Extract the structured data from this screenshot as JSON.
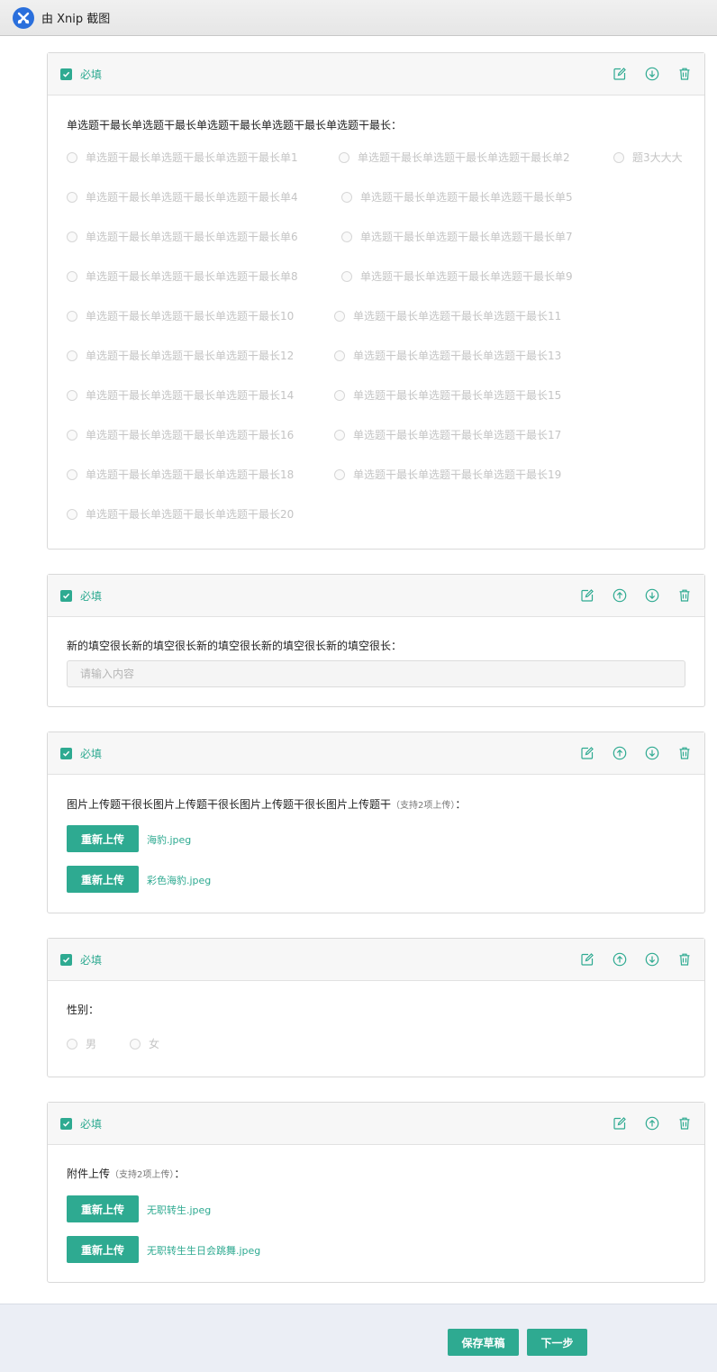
{
  "window": {
    "title": "由 Xnip 截图"
  },
  "colors": {
    "accent": "#2eaa91",
    "disabled_text": "#c4c4c4",
    "footer_bg": "#ebeef5"
  },
  "cards": [
    {
      "required_label": "必填",
      "title": "单选题干最长单选题干最长单选题干最长单选题干最长单选题干最长：",
      "options": [
        "单选题干最长单选题干最长单选题干最长单1",
        "单选题干最长单选题干最长单选题干最长单2",
        "题3大大大",
        "单选题干最长单选题干最长单选题干最长单4",
        "单选题干最长单选题干最长单选题干最长单5",
        "单选题干最长单选题干最长单选题干最长单6",
        "单选题干最长单选题干最长单选题干最长单7",
        "单选题干最长单选题干最长单选题干最长单8",
        "单选题干最长单选题干最长单选题干最长单9",
        "单选题干最长单选题干最长单选题干最长10",
        "单选题干最长单选题干最长单选题干最长11",
        "单选题干最长单选题干最长单选题干最长12",
        "单选题干最长单选题干最长单选题干最长13",
        "单选题干最长单选题干最长单选题干最长14",
        "单选题干最长单选题干最长单选题干最长15",
        "单选题干最长单选题干最长单选题干最长16",
        "单选题干最长单选题干最长单选题干最长17",
        "单选题干最长单选题干最长单选题干最长18",
        "单选题干最长单选题干最长单选题干最长19",
        "单选题干最长单选题干最长单选题干最长20"
      ]
    },
    {
      "required_label": "必填",
      "title": "新的填空很长新的填空很长新的填空很长新的填空很长新的填空很长：",
      "input_placeholder": "请输入内容"
    },
    {
      "required_label": "必填",
      "title": "图片上传题干很长图片上传题干很长图片上传题干很长图片上传题干",
      "title_note": "（支持2项上传）",
      "title_suffix": "：",
      "uploads": [
        {
          "button": "重新上传",
          "file": "海豹.jpeg"
        },
        {
          "button": "重新上传",
          "file": "彩色海豹.jpeg"
        }
      ]
    },
    {
      "required_label": "必填",
      "title": "性别：",
      "options": [
        "男",
        "女"
      ]
    },
    {
      "required_label": "必填",
      "title": "附件上传",
      "title_note": "（支持2项上传）",
      "title_suffix": "：",
      "uploads": [
        {
          "button": "重新上传",
          "file": "无职转生.jpeg"
        },
        {
          "button": "重新上传",
          "file": "无职转生生日会跳舞.jpeg"
        }
      ]
    }
  ],
  "footer": {
    "save_draft": "保存草稿",
    "next": "下一步"
  }
}
